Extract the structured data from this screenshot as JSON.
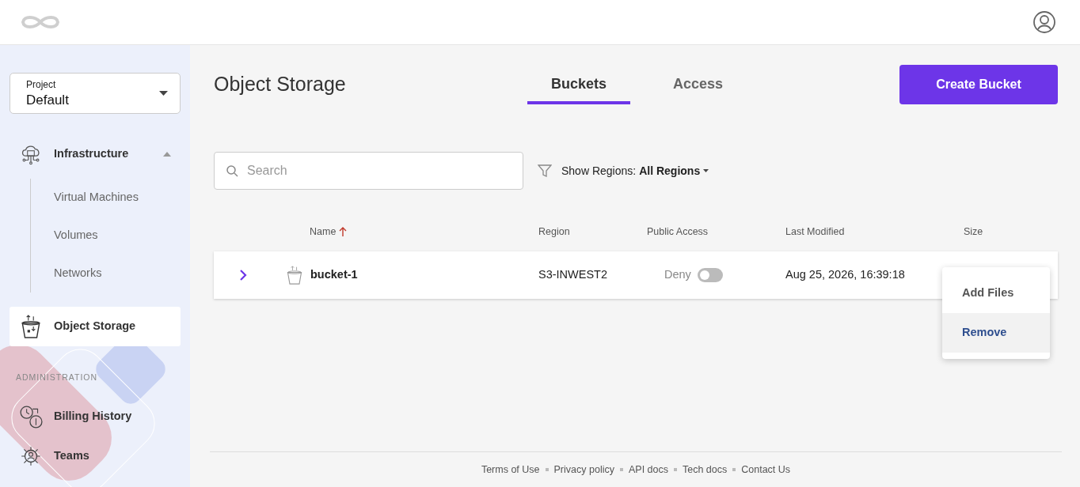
{
  "project_select": {
    "label": "Project",
    "value": "Default"
  },
  "sidebar": {
    "groups": [
      {
        "kind": "group",
        "label": "Infrastructure",
        "expanded": true,
        "selected": false,
        "children": [
          {
            "label": "Virtual Machines",
            "selected": false
          },
          {
            "label": "Volumes",
            "selected": false
          },
          {
            "label": "Networks",
            "selected": false
          }
        ]
      },
      {
        "kind": "item",
        "label": "Object Storage",
        "selected": true
      },
      {
        "kind": "heading",
        "label": "ADMINISTRATION"
      },
      {
        "kind": "item",
        "label": "Billing History",
        "selected": false
      },
      {
        "kind": "item",
        "label": "Teams",
        "selected": false
      }
    ]
  },
  "page_title": "Object Storage",
  "tabs": [
    {
      "label": "Buckets",
      "selected": true
    },
    {
      "label": "Access",
      "selected": false
    }
  ],
  "create_button": "Create Bucket",
  "search": {
    "placeholder": "Search"
  },
  "region_filter": {
    "label": "Show Regions:",
    "value": "All Regions"
  },
  "table": {
    "columns": [
      {
        "label": "Name",
        "sorted": true
      },
      {
        "label": "Region",
        "sorted": false
      },
      {
        "label": "Public Access",
        "sorted": false
      },
      {
        "label": "Last Modified",
        "sorted": false
      },
      {
        "label": "Size",
        "sorted": false
      }
    ],
    "rows": [
      {
        "name": "bucket-1",
        "region": "S3-INWEST2",
        "access": "Deny",
        "public": false,
        "expanded": false,
        "modified": "Aug 25, 2026, 16:39:18"
      }
    ]
  },
  "context_menu": [
    {
      "label": "Add Files",
      "selected": false
    },
    {
      "label": "Remove",
      "selected": true
    }
  ],
  "footer_links": [
    "Terms of Use",
    "Privacy policy",
    "API docs",
    "Tech docs",
    "Contact Us"
  ]
}
